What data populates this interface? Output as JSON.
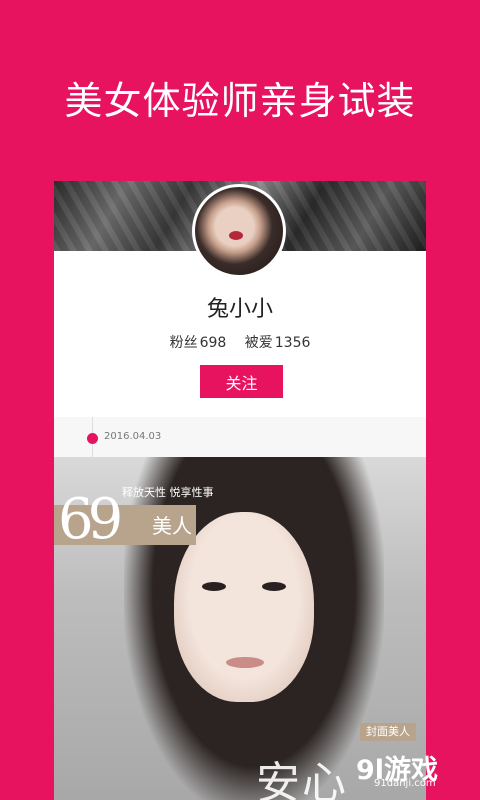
{
  "headline": "美女体验师亲身试装",
  "profile": {
    "nickname": "兔小小",
    "fans_label": "粉丝",
    "fans_count": "698",
    "likes_label": "被爱",
    "likes_count": "1356",
    "follow_label": "关注"
  },
  "timeline": {
    "date": "2016.04.03"
  },
  "post": {
    "magazine_number": "69",
    "magazine_title": "美人",
    "tagline": "释放天性 悦享性事",
    "cover_tag": "封面美人",
    "cover_text": "安心"
  },
  "watermark": {
    "logo": "9l游戏",
    "url": "91danji.com"
  },
  "colors": {
    "brand": "#e8135f",
    "card": "#ffffff",
    "magazine_accent": "#b8a48c"
  }
}
